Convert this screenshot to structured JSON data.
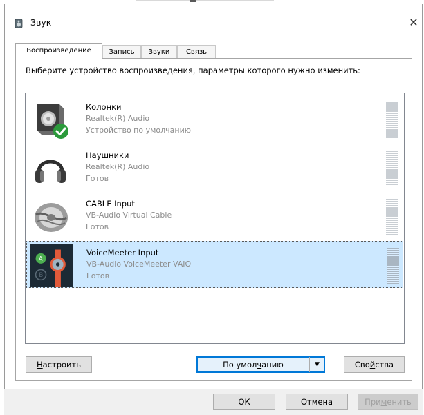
{
  "window": {
    "title": "Звук",
    "close_glyph": "✕"
  },
  "tabs": [
    {
      "label": "Воспроизведение",
      "active": true
    },
    {
      "label": "Запись",
      "active": false
    },
    {
      "label": "Звуки",
      "active": false
    },
    {
      "label": "Связь",
      "active": false
    }
  ],
  "instruction": "Выберите устройство воспроизведения, параметры которого нужно изменить:",
  "devices": [
    {
      "name": "Колонки",
      "driver": "Realtek(R) Audio",
      "status": "Устройство по умолчанию",
      "icon": "speaker-icon",
      "is_default": true,
      "selected": false
    },
    {
      "name": "Наушники",
      "driver": "Realtek(R) Audio",
      "status": "Готов",
      "icon": "headphones-icon",
      "is_default": false,
      "selected": false
    },
    {
      "name": "CABLE Input",
      "driver": "VB-Audio Virtual Cable",
      "status": "Готов",
      "icon": "cable-icon",
      "is_default": false,
      "selected": false
    },
    {
      "name": "VoiceMeeter Input",
      "driver": "VB-Audio VoiceMeeter VAIO",
      "status": "Готов",
      "icon": "voicemeeter-icon",
      "is_default": false,
      "selected": true
    }
  ],
  "buttons": {
    "configure": {
      "pre": "",
      "accel": "Н",
      "post": "астроить"
    },
    "set_default": {
      "pre": "По умол",
      "accel": "ч",
      "post": "анию",
      "arrow": "▼"
    },
    "properties": {
      "pre": "Сво",
      "accel": "й",
      "post": "ства"
    },
    "ok": "ОК",
    "cancel": "Отмена",
    "apply": {
      "pre": "При",
      "accel": "м",
      "post": "енить"
    }
  },
  "colors": {
    "selection": "#cce8ff",
    "default_check": "#2b9a3b",
    "focus_border": "#0078d7"
  }
}
